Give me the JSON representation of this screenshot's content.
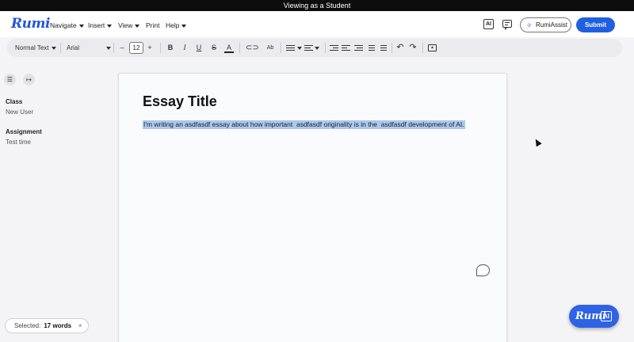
{
  "banner": {
    "text": "Viewing as a Student"
  },
  "app": {
    "logo_text": "Rumi",
    "brand_color": "#2456d6"
  },
  "menu": {
    "items": [
      {
        "label": "Navigate",
        "has_caret": true
      },
      {
        "label": "Insert",
        "has_caret": true
      },
      {
        "label": "View",
        "has_caret": true
      },
      {
        "label": "Print",
        "has_caret": false
      },
      {
        "label": "Help",
        "has_caret": true
      }
    ]
  },
  "header_actions": {
    "ai_icon_label": "AI",
    "rumiassist_label": "RumiAssist",
    "submit_label": "Submit",
    "submit_color": "#1f5fe0"
  },
  "toolbar": {
    "style_select": "Normal Text",
    "font_select": "Arial",
    "font_size": "12",
    "decrease_label": "–",
    "increase_label": "+",
    "bold_label": "B",
    "italic_label": "I",
    "underline_label": "U",
    "strike_label": "S",
    "color_label": "A",
    "superscript_label": "Ab"
  },
  "sidebar": {
    "class_label": "Class",
    "class_value": "New User",
    "assignment_label": "Assignment",
    "assignment_value": "Test time"
  },
  "document": {
    "title": "Essay Title",
    "body": "I'm writing an asdfasdf essay about how important  asdfasdf originality is in the  asdfasdf development of AI.",
    "selection_color": "#aac8f0"
  },
  "status": {
    "selected_label": "Selected:",
    "selected_count": "17 words",
    "close_label": "×"
  },
  "rumi_ai_button": {
    "text": "Rumi",
    "ai_tag": "AI"
  }
}
